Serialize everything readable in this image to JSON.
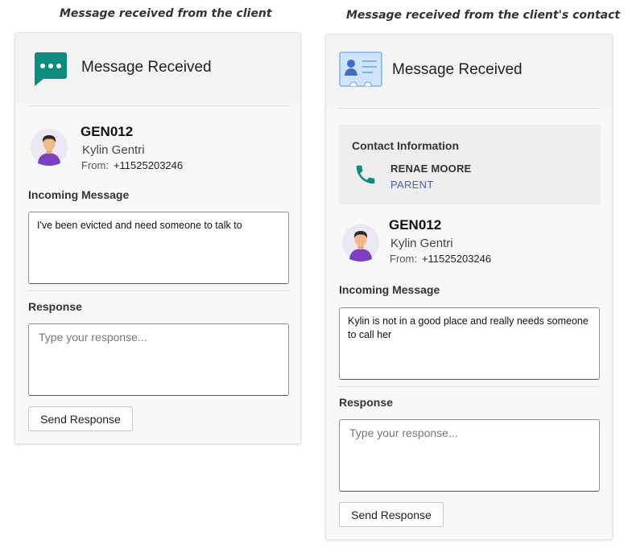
{
  "captions": {
    "left": "Message received from the client",
    "right": "Message received from the client's contact"
  },
  "left_card": {
    "header_title": "Message Received",
    "header_icon": "chat-bubble-icon",
    "client": {
      "id": "GEN012",
      "name": "Kylin Gentri",
      "from_label": "From:",
      "phone": "+11525203246"
    },
    "incoming_label": "Incoming Message",
    "incoming_text": "I've been evicted and need someone to talk to",
    "response_label": "Response",
    "response_placeholder": "Type your response...",
    "send_label": "Send Response"
  },
  "right_card": {
    "header_title": "Message Received",
    "header_icon": "contact-card-icon",
    "contact": {
      "heading": "Contact Information",
      "name": "RENAE MOORE",
      "role": "PARENT",
      "icon": "phone-icon"
    },
    "client": {
      "id": "GEN012",
      "name": "Kylin Gentri",
      "from_label": "From:",
      "phone": "+11525203246"
    },
    "incoming_label": "Incoming Message",
    "incoming_text": "Kylin is not in a good place and really needs someone to call her",
    "response_label": "Response",
    "response_placeholder": "Type your response...",
    "send_label": "Send Response"
  },
  "colors": {
    "chat_icon": "#0e8c7f",
    "phone_icon": "#0e8c7f",
    "contact_role": "#4a5fc1",
    "avatar_bg": "#ece6f5",
    "avatar_shirt": "#7b3fc4"
  }
}
